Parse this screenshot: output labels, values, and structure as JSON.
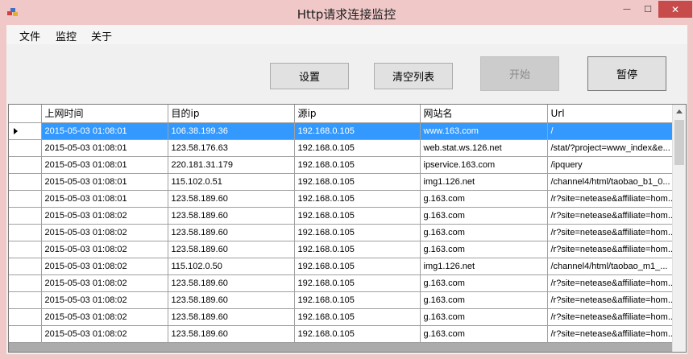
{
  "window": {
    "title": "Http请求连接监控",
    "min_glyph": "—",
    "max_glyph": "☐",
    "close_glyph": "✕",
    "icon": "app-icon"
  },
  "menu": {
    "items": [
      "文件",
      "监控",
      "关于"
    ]
  },
  "toolbar": {
    "settings_label": "设置",
    "clear_label": "清空列表",
    "start_label": "开始",
    "start_enabled": false,
    "pause_label": "暂停"
  },
  "grid": {
    "columns": [
      "上网时间",
      "目的ip",
      "源ip",
      "网站名",
      "Url"
    ],
    "selected_row": 0,
    "rows": [
      [
        "2015-05-03 01:08:01",
        "106.38.199.36",
        "192.168.0.105",
        "www.163.com",
        "/"
      ],
      [
        "2015-05-03 01:08:01",
        "123.58.176.63",
        "192.168.0.105",
        "web.stat.ws.126.net",
        "/stat/?project=www_index&e..."
      ],
      [
        "2015-05-03 01:08:01",
        "220.181.31.179",
        "192.168.0.105",
        "ipservice.163.com",
        "/ipquery"
      ],
      [
        "2015-05-03 01:08:01",
        "115.102.0.51",
        "192.168.0.105",
        "img1.126.net",
        "/channel4/html/taobao_b1_0..."
      ],
      [
        "2015-05-03 01:08:01",
        "123.58.189.60",
        "192.168.0.105",
        "g.163.com",
        "/r?site=netease&affiliate=hom..."
      ],
      [
        "2015-05-03 01:08:02",
        "123.58.189.60",
        "192.168.0.105",
        "g.163.com",
        "/r?site=netease&affiliate=hom..."
      ],
      [
        "2015-05-03 01:08:02",
        "123.58.189.60",
        "192.168.0.105",
        "g.163.com",
        "/r?site=netease&affiliate=hom..."
      ],
      [
        "2015-05-03 01:08:02",
        "123.58.189.60",
        "192.168.0.105",
        "g.163.com",
        "/r?site=netease&affiliate=hom..."
      ],
      [
        "2015-05-03 01:08:02",
        "115.102.0.50",
        "192.168.0.105",
        "img1.126.net",
        "/channel4/html/taobao_m1_..."
      ],
      [
        "2015-05-03 01:08:02",
        "123.58.189.60",
        "192.168.0.105",
        "g.163.com",
        "/r?site=netease&affiliate=hom..."
      ],
      [
        "2015-05-03 01:08:02",
        "123.58.189.60",
        "192.168.0.105",
        "g.163.com",
        "/r?site=netease&affiliate=hom..."
      ],
      [
        "2015-05-03 01:08:02",
        "123.58.189.60",
        "192.168.0.105",
        "g.163.com",
        "/r?site=netease&affiliate=hom..."
      ],
      [
        "2015-05-03 01:08:02",
        "123.58.189.60",
        "192.168.0.105",
        "g.163.com",
        "/r?site=netease&affiliate=hom..."
      ]
    ]
  },
  "colors": {
    "titlebar": "#f0c8c8",
    "close_button": "#c74b4b",
    "selection": "#3399ff"
  }
}
